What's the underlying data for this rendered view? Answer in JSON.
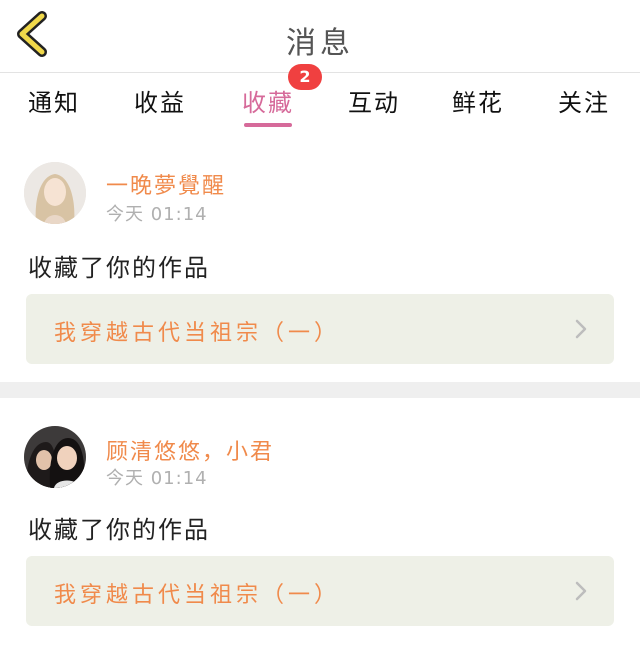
{
  "header": {
    "title": "消息",
    "back_icon": "chevron-left-icon",
    "accent": "#f0d84a"
  },
  "tabs": [
    {
      "label": "通知"
    },
    {
      "label": "收益"
    },
    {
      "label": "收藏",
      "active": true,
      "badge": "2"
    },
    {
      "label": "互动"
    },
    {
      "label": "鲜花"
    },
    {
      "label": "关注"
    }
  ],
  "colors": {
    "active_tab": "#d66a9a",
    "username": "#f08a4b",
    "badge": "#f04040",
    "work_box_bg": "#eef0e7"
  },
  "messages": [
    {
      "username": "一晚夢覺醒",
      "time": "今天 01:14",
      "action": "收藏了你的作品",
      "work_title": "我穿越古代当祖宗（一）"
    },
    {
      "username": "顾清悠悠，小君",
      "time": "今天 01:14",
      "action": "收藏了你的作品",
      "work_title": "我穿越古代当祖宗（一）"
    }
  ]
}
